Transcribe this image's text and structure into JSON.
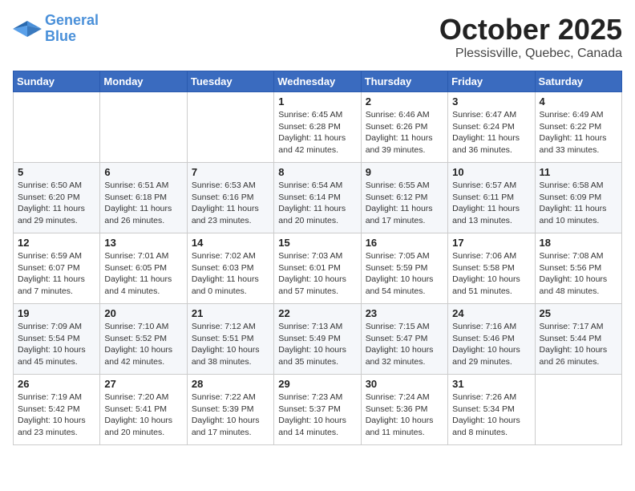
{
  "header": {
    "logo": {
      "line1": "General",
      "line2": "Blue"
    },
    "month": "October 2025",
    "location": "Plessisville, Quebec, Canada"
  },
  "days_of_week": [
    "Sunday",
    "Monday",
    "Tuesday",
    "Wednesday",
    "Thursday",
    "Friday",
    "Saturday"
  ],
  "weeks": [
    [
      {
        "num": "",
        "sunrise": "",
        "sunset": "",
        "daylight": ""
      },
      {
        "num": "",
        "sunrise": "",
        "sunset": "",
        "daylight": ""
      },
      {
        "num": "",
        "sunrise": "",
        "sunset": "",
        "daylight": ""
      },
      {
        "num": "1",
        "sunrise": "Sunrise: 6:45 AM",
        "sunset": "Sunset: 6:28 PM",
        "daylight": "Daylight: 11 hours and 42 minutes."
      },
      {
        "num": "2",
        "sunrise": "Sunrise: 6:46 AM",
        "sunset": "Sunset: 6:26 PM",
        "daylight": "Daylight: 11 hours and 39 minutes."
      },
      {
        "num": "3",
        "sunrise": "Sunrise: 6:47 AM",
        "sunset": "Sunset: 6:24 PM",
        "daylight": "Daylight: 11 hours and 36 minutes."
      },
      {
        "num": "4",
        "sunrise": "Sunrise: 6:49 AM",
        "sunset": "Sunset: 6:22 PM",
        "daylight": "Daylight: 11 hours and 33 minutes."
      }
    ],
    [
      {
        "num": "5",
        "sunrise": "Sunrise: 6:50 AM",
        "sunset": "Sunset: 6:20 PM",
        "daylight": "Daylight: 11 hours and 29 minutes."
      },
      {
        "num": "6",
        "sunrise": "Sunrise: 6:51 AM",
        "sunset": "Sunset: 6:18 PM",
        "daylight": "Daylight: 11 hours and 26 minutes."
      },
      {
        "num": "7",
        "sunrise": "Sunrise: 6:53 AM",
        "sunset": "Sunset: 6:16 PM",
        "daylight": "Daylight: 11 hours and 23 minutes."
      },
      {
        "num": "8",
        "sunrise": "Sunrise: 6:54 AM",
        "sunset": "Sunset: 6:14 PM",
        "daylight": "Daylight: 11 hours and 20 minutes."
      },
      {
        "num": "9",
        "sunrise": "Sunrise: 6:55 AM",
        "sunset": "Sunset: 6:12 PM",
        "daylight": "Daylight: 11 hours and 17 minutes."
      },
      {
        "num": "10",
        "sunrise": "Sunrise: 6:57 AM",
        "sunset": "Sunset: 6:11 PM",
        "daylight": "Daylight: 11 hours and 13 minutes."
      },
      {
        "num": "11",
        "sunrise": "Sunrise: 6:58 AM",
        "sunset": "Sunset: 6:09 PM",
        "daylight": "Daylight: 11 hours and 10 minutes."
      }
    ],
    [
      {
        "num": "12",
        "sunrise": "Sunrise: 6:59 AM",
        "sunset": "Sunset: 6:07 PM",
        "daylight": "Daylight: 11 hours and 7 minutes."
      },
      {
        "num": "13",
        "sunrise": "Sunrise: 7:01 AM",
        "sunset": "Sunset: 6:05 PM",
        "daylight": "Daylight: 11 hours and 4 minutes."
      },
      {
        "num": "14",
        "sunrise": "Sunrise: 7:02 AM",
        "sunset": "Sunset: 6:03 PM",
        "daylight": "Daylight: 11 hours and 0 minutes."
      },
      {
        "num": "15",
        "sunrise": "Sunrise: 7:03 AM",
        "sunset": "Sunset: 6:01 PM",
        "daylight": "Daylight: 10 hours and 57 minutes."
      },
      {
        "num": "16",
        "sunrise": "Sunrise: 7:05 AM",
        "sunset": "Sunset: 5:59 PM",
        "daylight": "Daylight: 10 hours and 54 minutes."
      },
      {
        "num": "17",
        "sunrise": "Sunrise: 7:06 AM",
        "sunset": "Sunset: 5:58 PM",
        "daylight": "Daylight: 10 hours and 51 minutes."
      },
      {
        "num": "18",
        "sunrise": "Sunrise: 7:08 AM",
        "sunset": "Sunset: 5:56 PM",
        "daylight": "Daylight: 10 hours and 48 minutes."
      }
    ],
    [
      {
        "num": "19",
        "sunrise": "Sunrise: 7:09 AM",
        "sunset": "Sunset: 5:54 PM",
        "daylight": "Daylight: 10 hours and 45 minutes."
      },
      {
        "num": "20",
        "sunrise": "Sunrise: 7:10 AM",
        "sunset": "Sunset: 5:52 PM",
        "daylight": "Daylight: 10 hours and 42 minutes."
      },
      {
        "num": "21",
        "sunrise": "Sunrise: 7:12 AM",
        "sunset": "Sunset: 5:51 PM",
        "daylight": "Daylight: 10 hours and 38 minutes."
      },
      {
        "num": "22",
        "sunrise": "Sunrise: 7:13 AM",
        "sunset": "Sunset: 5:49 PM",
        "daylight": "Daylight: 10 hours and 35 minutes."
      },
      {
        "num": "23",
        "sunrise": "Sunrise: 7:15 AM",
        "sunset": "Sunset: 5:47 PM",
        "daylight": "Daylight: 10 hours and 32 minutes."
      },
      {
        "num": "24",
        "sunrise": "Sunrise: 7:16 AM",
        "sunset": "Sunset: 5:46 PM",
        "daylight": "Daylight: 10 hours and 29 minutes."
      },
      {
        "num": "25",
        "sunrise": "Sunrise: 7:17 AM",
        "sunset": "Sunset: 5:44 PM",
        "daylight": "Daylight: 10 hours and 26 minutes."
      }
    ],
    [
      {
        "num": "26",
        "sunrise": "Sunrise: 7:19 AM",
        "sunset": "Sunset: 5:42 PM",
        "daylight": "Daylight: 10 hours and 23 minutes."
      },
      {
        "num": "27",
        "sunrise": "Sunrise: 7:20 AM",
        "sunset": "Sunset: 5:41 PM",
        "daylight": "Daylight: 10 hours and 20 minutes."
      },
      {
        "num": "28",
        "sunrise": "Sunrise: 7:22 AM",
        "sunset": "Sunset: 5:39 PM",
        "daylight": "Daylight: 10 hours and 17 minutes."
      },
      {
        "num": "29",
        "sunrise": "Sunrise: 7:23 AM",
        "sunset": "Sunset: 5:37 PM",
        "daylight": "Daylight: 10 hours and 14 minutes."
      },
      {
        "num": "30",
        "sunrise": "Sunrise: 7:24 AM",
        "sunset": "Sunset: 5:36 PM",
        "daylight": "Daylight: 10 hours and 11 minutes."
      },
      {
        "num": "31",
        "sunrise": "Sunrise: 7:26 AM",
        "sunset": "Sunset: 5:34 PM",
        "daylight": "Daylight: 10 hours and 8 minutes."
      },
      {
        "num": "",
        "sunrise": "",
        "sunset": "",
        "daylight": ""
      }
    ]
  ]
}
